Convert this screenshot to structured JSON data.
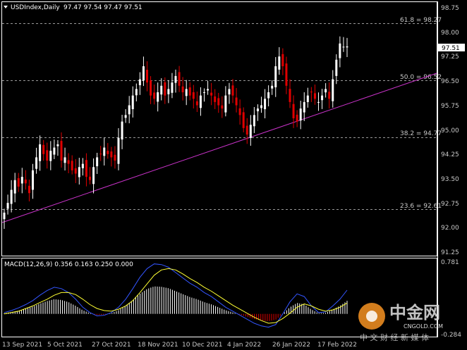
{
  "header": {
    "symbol": "USDIndex,Daily",
    "ohlc": "97.47 97.54 97.47 97.51"
  },
  "macd": {
    "label": "MACD(12,26,9) 0.356 0.163 0.250 0.000",
    "axis_ticks": [
      "0.781",
      "-0.284"
    ]
  },
  "watermark": {
    "logo_text": "中金网",
    "url": "CNGOLD.COM",
    "tagline": "中 文 财 经 新 媒 体"
  },
  "chart_data": {
    "type": "candlestick",
    "symbol": "USDIndex",
    "timeframe": "Daily",
    "price_axis_ticks": [
      98.0,
      97.25,
      96.5,
      95.75,
      95.0,
      94.25,
      93.5,
      92.75,
      92.0,
      91.25
    ],
    "price_axis_labels": [
      "98.75",
      "98.00",
      "97.25",
      "96.50",
      "95.75",
      "95.00",
      "94.25",
      "93.50",
      "92.75",
      "92.00",
      "91.25"
    ],
    "ylim": [
      91.1,
      98.85
    ],
    "current_price": "97.51",
    "x_labels": [
      "13 Sep 2021",
      "5 Oct 2021",
      "27 Oct 2021",
      "18 Nov 2021",
      "10 Dec 2021",
      "4 Jan 2022",
      "26 Jan 2022",
      "17 Feb 2022"
    ],
    "fib_levels": [
      {
        "label": "61.8 = 98.27",
        "value": 98.27
      },
      {
        "label": "50.0 = 96.52",
        "value": 96.52
      },
      {
        "label": "38.2 = 94.77",
        "value": 94.77
      },
      {
        "label": "23.6 = 92.61",
        "value": 92.61
      }
    ],
    "trendline": {
      "from": {
        "bar": 0,
        "price": 92.2
      },
      "to": {
        "bar": 116,
        "price": 96.8
      },
      "color": "#cc33cc"
    },
    "closes": [
      92.4,
      92.7,
      93.1,
      93.4,
      93.2,
      93.5,
      93.3,
      93.0,
      93.7,
      94.1,
      94.5,
      94.2,
      94.0,
      94.3,
      94.4,
      94.5,
      94.0,
      94.1,
      93.9,
      93.7,
      93.6,
      93.8,
      93.9,
      93.5,
      93.4,
      93.8,
      94.1,
      94.2,
      94.4,
      94.2,
      94.1,
      94.0,
      94.7,
      95.2,
      95.4,
      95.7,
      96.0,
      96.2,
      96.5,
      96.9,
      96.4,
      96.0,
      95.9,
      96.1,
      96.3,
      96.0,
      96.2,
      96.4,
      96.6,
      96.3,
      96.1,
      96.2,
      96.0,
      95.9,
      95.7,
      96.0,
      96.1,
      96.2,
      96.0,
      95.8,
      95.7,
      95.6,
      96.0,
      96.2,
      96.0,
      95.7,
      95.4,
      95.0,
      94.8,
      95.1,
      95.4,
      95.6,
      95.7,
      95.9,
      96.1,
      96.3,
      96.9,
      97.2,
      96.9,
      96.3,
      95.8,
      95.3,
      95.2,
      95.6,
      95.8,
      96.0,
      96.1,
      95.9,
      95.8,
      96.0,
      96.2,
      95.9,
      96.5,
      97.1,
      97.6,
      97.5,
      97.51
    ],
    "macd_line": [
      0.02,
      0.05,
      0.09,
      0.14,
      0.2,
      0.28,
      0.35,
      0.4,
      0.38,
      0.32,
      0.22,
      0.1,
      0.02,
      -0.03,
      -0.02,
      0.02,
      0.1,
      0.22,
      0.38,
      0.55,
      0.68,
      0.75,
      0.74,
      0.7,
      0.62,
      0.54,
      0.46,
      0.4,
      0.32,
      0.26,
      0.18,
      0.1,
      0.04,
      -0.02,
      -0.08,
      -0.14,
      -0.18,
      -0.2,
      -0.16,
      0.0,
      0.18,
      0.3,
      0.26,
      0.12,
      0.02,
      0.03,
      0.12,
      0.22,
      0.356
    ],
    "signal_line": [
      0.0,
      0.02,
      0.04,
      0.08,
      0.12,
      0.17,
      0.22,
      0.28,
      0.32,
      0.32,
      0.29,
      0.22,
      0.14,
      0.08,
      0.05,
      0.04,
      0.07,
      0.12,
      0.2,
      0.32,
      0.45,
      0.58,
      0.66,
      0.68,
      0.66,
      0.6,
      0.53,
      0.47,
      0.4,
      0.34,
      0.27,
      0.2,
      0.13,
      0.07,
      0.01,
      -0.05,
      -0.1,
      -0.14,
      -0.13,
      -0.07,
      0.01,
      0.1,
      0.15,
      0.12,
      0.07,
      0.04,
      0.06,
      0.1,
      0.163
    ],
    "macd_ylim": [
      -0.32,
      0.8
    ]
  }
}
